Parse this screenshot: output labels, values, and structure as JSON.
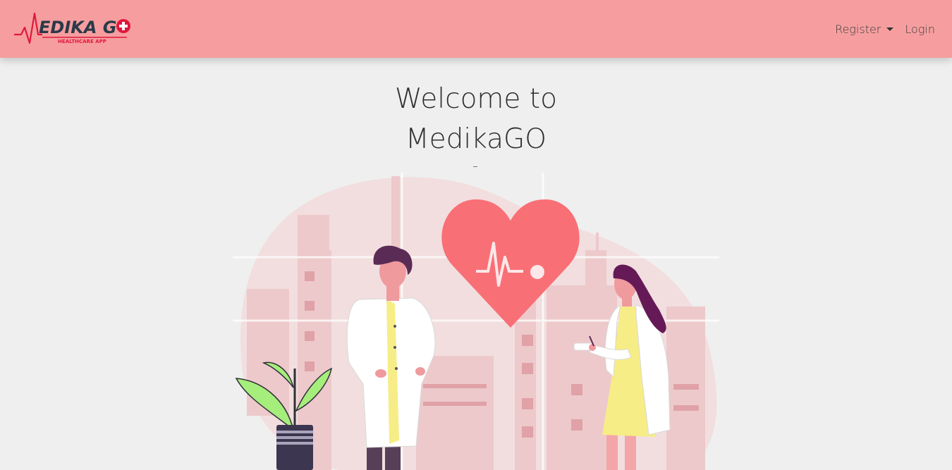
{
  "brand": {
    "logo_text": "MEDIKA GO",
    "logo_tagline": "HEALTHCARE APP",
    "colors": {
      "dark": "#2b3a4a",
      "accent": "#e0183c"
    }
  },
  "nav": {
    "register_label": "Register",
    "login_label": "Login"
  },
  "hero": {
    "title_line1": "Welcome to",
    "title_line2": "MedikaGO",
    "illustration": "doctors-heart-illustration"
  },
  "theme": {
    "navbar_bg": "#f69e9f",
    "page_bg": "#efefef",
    "heart": "#f96f76"
  }
}
